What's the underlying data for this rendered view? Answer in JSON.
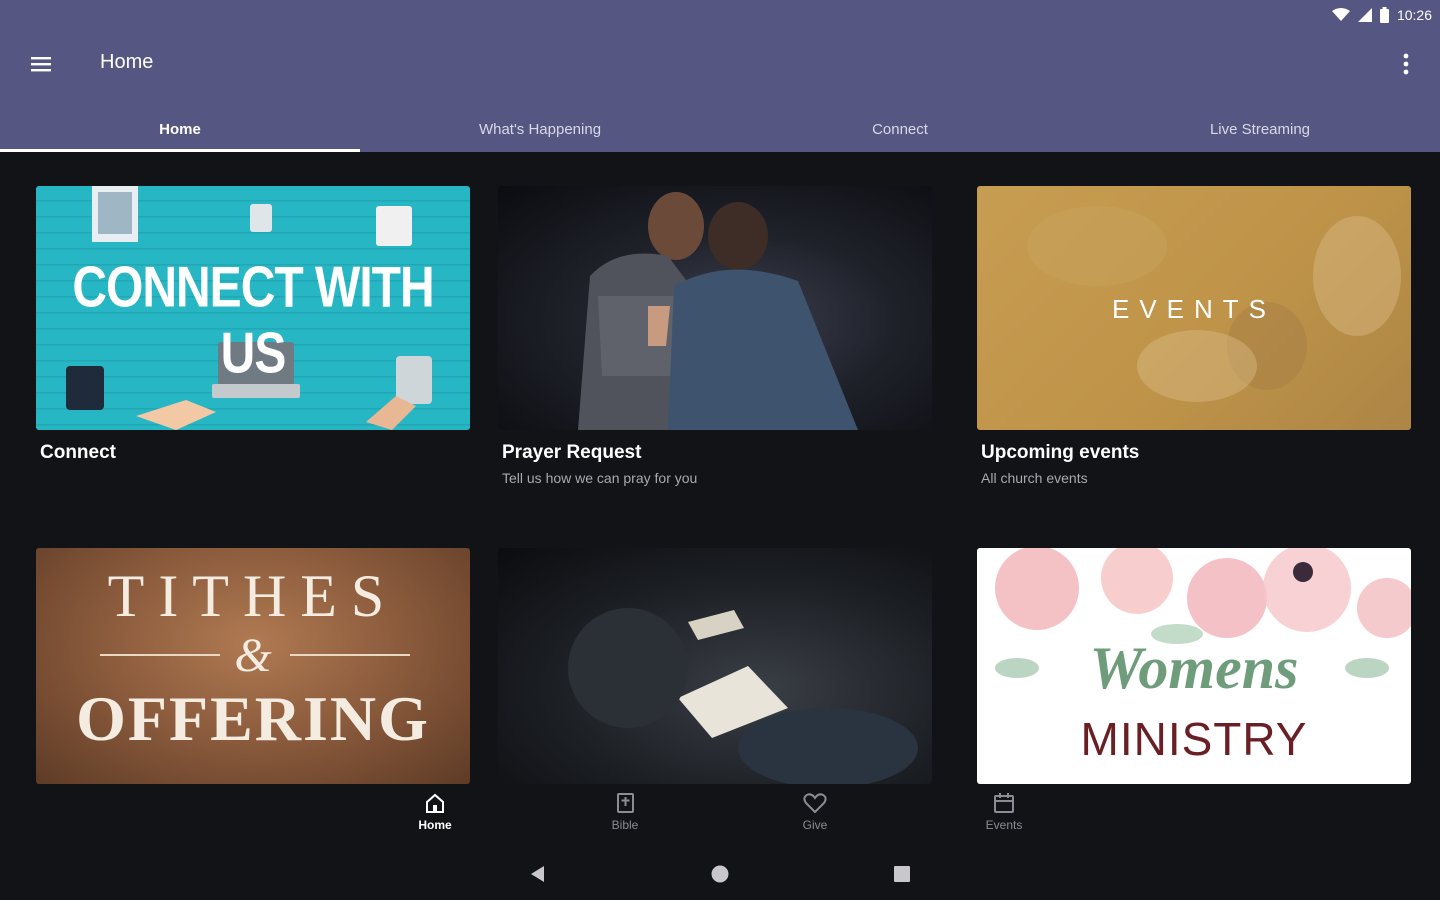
{
  "status": {
    "time": "10:26",
    "icons": [
      "wifi-icon",
      "signal-icon",
      "battery-icon"
    ]
  },
  "appbar": {
    "title": "Home",
    "menu_icon": "hamburger-menu-icon",
    "overflow_icon": "more-vert-icon"
  },
  "tabs": [
    {
      "label": "Home",
      "active": true
    },
    {
      "label": "What's Happening",
      "active": false
    },
    {
      "label": "Connect",
      "active": false
    },
    {
      "label": "Live Streaming",
      "active": false
    }
  ],
  "cards": [
    {
      "image_text": "CONNECT WITH US",
      "title": "Connect",
      "subtitle": ""
    },
    {
      "image_text": "",
      "title": "Prayer Request",
      "subtitle": "Tell us how we can pray for you"
    },
    {
      "image_text": "EVENTS",
      "title": "Upcoming events",
      "subtitle": "All church events"
    },
    {
      "image_text_top": "TITHES",
      "image_text_mid": "&",
      "image_text_bottom": "OFFERING",
      "title": "",
      "subtitle": ""
    },
    {
      "image_text": "",
      "title": "",
      "subtitle": ""
    },
    {
      "image_text_top": "Womens",
      "image_text_bottom": "MINISTRY",
      "title": "",
      "subtitle": ""
    }
  ],
  "bottom_nav": [
    {
      "label": "Home",
      "icon": "home-icon",
      "active": true
    },
    {
      "label": "Bible",
      "icon": "bible-icon",
      "active": false
    },
    {
      "label": "Give",
      "icon": "heart-icon",
      "active": false
    },
    {
      "label": "Events",
      "icon": "calendar-icon",
      "active": false
    }
  ],
  "system_nav": [
    "back-icon",
    "home-circle-icon",
    "recents-icon"
  ],
  "colors": {
    "primary": "#565682",
    "background": "#121316",
    "muted_text": "#a8a8b0"
  }
}
